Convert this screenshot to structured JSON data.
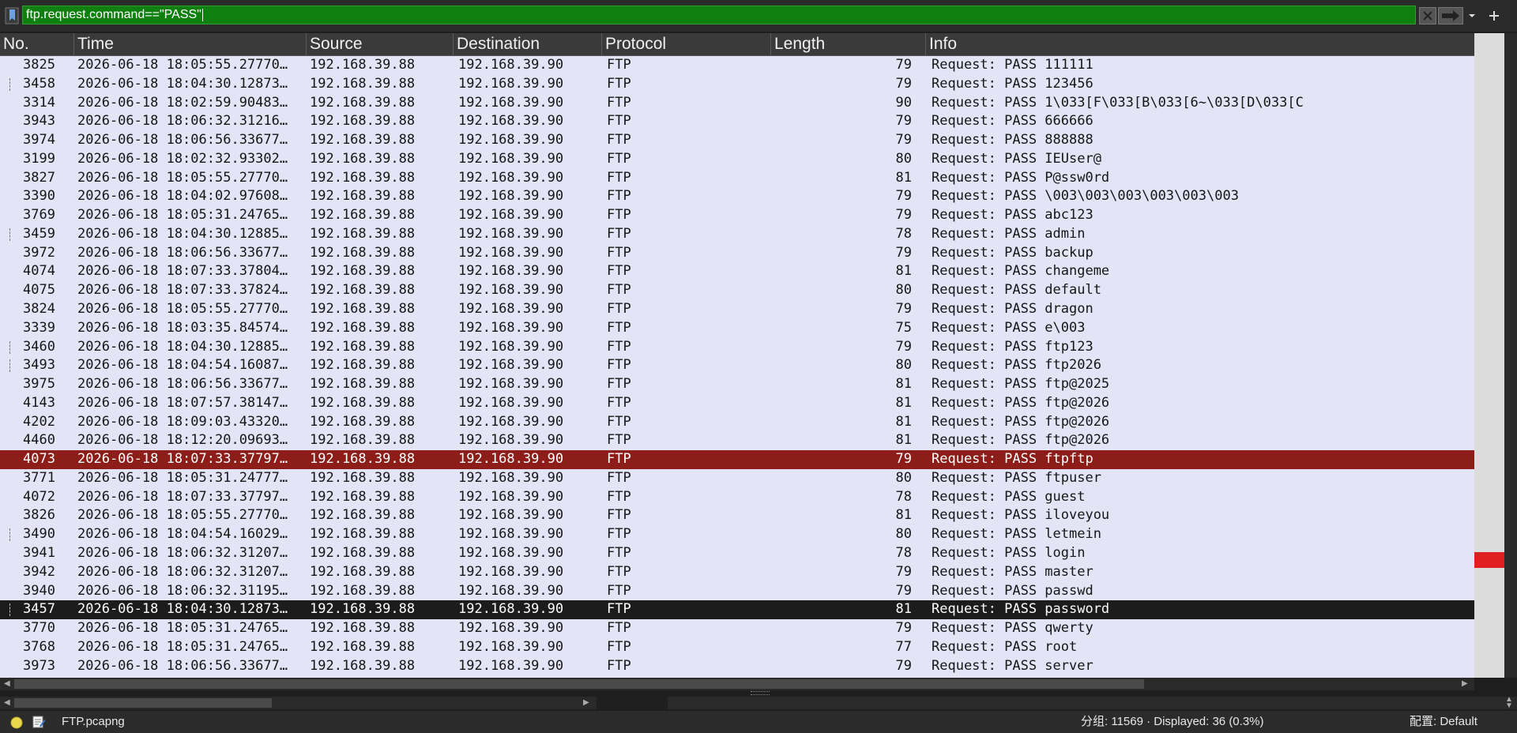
{
  "filter": {
    "expression": "ftp.request.command==\"PASS\"",
    "bookmark_icon": "bookmark-icon",
    "clear_icon": "clear-icon",
    "apply_icon": "arrow-right-icon",
    "dropdown_icon": "chevron-down-icon",
    "add_icon": "plus-icon",
    "active_color": "#0f7f0f"
  },
  "columns": [
    "No.",
    "Time",
    "Source",
    "Destination",
    "Protocol",
    "Length",
    "Info"
  ],
  "selection_colors": {
    "marked": "#8c1d18",
    "selected": "#1c1c1c",
    "row_bg": "#e4e4f7"
  },
  "packets": [
    {
      "no": "3825",
      "time": "2026-06-18 18:05:55.27770…",
      "src": "192.168.39.88",
      "dst": "192.168.39.90",
      "proto": "FTP",
      "len": "79",
      "info": "Request: PASS 111111",
      "state": "normal",
      "related": false
    },
    {
      "no": "3458",
      "time": "2026-06-18 18:04:30.12873…",
      "src": "192.168.39.88",
      "dst": "192.168.39.90",
      "proto": "FTP",
      "len": "79",
      "info": "Request: PASS 123456",
      "state": "normal",
      "related": true
    },
    {
      "no": "3314",
      "time": "2026-06-18 18:02:59.90483…",
      "src": "192.168.39.88",
      "dst": "192.168.39.90",
      "proto": "FTP",
      "len": "90",
      "info": "Request: PASS 1\\033[F\\033[B\\033[6~\\033[D\\033[C",
      "state": "normal",
      "related": false
    },
    {
      "no": "3943",
      "time": "2026-06-18 18:06:32.31216…",
      "src": "192.168.39.88",
      "dst": "192.168.39.90",
      "proto": "FTP",
      "len": "79",
      "info": "Request: PASS 666666",
      "state": "normal",
      "related": false
    },
    {
      "no": "3974",
      "time": "2026-06-18 18:06:56.33677…",
      "src": "192.168.39.88",
      "dst": "192.168.39.90",
      "proto": "FTP",
      "len": "79",
      "info": "Request: PASS 888888",
      "state": "normal",
      "related": false
    },
    {
      "no": "3199",
      "time": "2026-06-18 18:02:32.93302…",
      "src": "192.168.39.88",
      "dst": "192.168.39.90",
      "proto": "FTP",
      "len": "80",
      "info": "Request: PASS IEUser@",
      "state": "normal",
      "related": false
    },
    {
      "no": "3827",
      "time": "2026-06-18 18:05:55.27770…",
      "src": "192.168.39.88",
      "dst": "192.168.39.90",
      "proto": "FTP",
      "len": "81",
      "info": "Request: PASS P@ssw0rd",
      "state": "normal",
      "related": false
    },
    {
      "no": "3390",
      "time": "2026-06-18 18:04:02.97608…",
      "src": "192.168.39.88",
      "dst": "192.168.39.90",
      "proto": "FTP",
      "len": "79",
      "info": "Request: PASS \\003\\003\\003\\003\\003\\003",
      "state": "normal",
      "related": false
    },
    {
      "no": "3769",
      "time": "2026-06-18 18:05:31.24765…",
      "src": "192.168.39.88",
      "dst": "192.168.39.90",
      "proto": "FTP",
      "len": "79",
      "info": "Request: PASS abc123",
      "state": "normal",
      "related": false
    },
    {
      "no": "3459",
      "time": "2026-06-18 18:04:30.12885…",
      "src": "192.168.39.88",
      "dst": "192.168.39.90",
      "proto": "FTP",
      "len": "78",
      "info": "Request: PASS admin",
      "state": "normal",
      "related": true
    },
    {
      "no": "3972",
      "time": "2026-06-18 18:06:56.33677…",
      "src": "192.168.39.88",
      "dst": "192.168.39.90",
      "proto": "FTP",
      "len": "79",
      "info": "Request: PASS backup",
      "state": "normal",
      "related": false
    },
    {
      "no": "4074",
      "time": "2026-06-18 18:07:33.37804…",
      "src": "192.168.39.88",
      "dst": "192.168.39.90",
      "proto": "FTP",
      "len": "81",
      "info": "Request: PASS changeme",
      "state": "normal",
      "related": false
    },
    {
      "no": "4075",
      "time": "2026-06-18 18:07:33.37824…",
      "src": "192.168.39.88",
      "dst": "192.168.39.90",
      "proto": "FTP",
      "len": "80",
      "info": "Request: PASS default",
      "state": "normal",
      "related": false
    },
    {
      "no": "3824",
      "time": "2026-06-18 18:05:55.27770…",
      "src": "192.168.39.88",
      "dst": "192.168.39.90",
      "proto": "FTP",
      "len": "79",
      "info": "Request: PASS dragon",
      "state": "normal",
      "related": false
    },
    {
      "no": "3339",
      "time": "2026-06-18 18:03:35.84574…",
      "src": "192.168.39.88",
      "dst": "192.168.39.90",
      "proto": "FTP",
      "len": "75",
      "info": "Request: PASS e\\003",
      "state": "normal",
      "related": false
    },
    {
      "no": "3460",
      "time": "2026-06-18 18:04:30.12885…",
      "src": "192.168.39.88",
      "dst": "192.168.39.90",
      "proto": "FTP",
      "len": "79",
      "info": "Request: PASS ftp123",
      "state": "normal",
      "related": true
    },
    {
      "no": "3493",
      "time": "2026-06-18 18:04:54.16087…",
      "src": "192.168.39.88",
      "dst": "192.168.39.90",
      "proto": "FTP",
      "len": "80",
      "info": "Request: PASS ftp2026",
      "state": "normal",
      "related": true
    },
    {
      "no": "3975",
      "time": "2026-06-18 18:06:56.33677…",
      "src": "192.168.39.88",
      "dst": "192.168.39.90",
      "proto": "FTP",
      "len": "81",
      "info": "Request: PASS ftp@2025",
      "state": "normal",
      "related": false
    },
    {
      "no": "4143",
      "time": "2026-06-18 18:07:57.38147…",
      "src": "192.168.39.88",
      "dst": "192.168.39.90",
      "proto": "FTP",
      "len": "81",
      "info": "Request: PASS ftp@2026",
      "state": "normal",
      "related": false
    },
    {
      "no": "4202",
      "time": "2026-06-18 18:09:03.43320…",
      "src": "192.168.39.88",
      "dst": "192.168.39.90",
      "proto": "FTP",
      "len": "81",
      "info": "Request: PASS ftp@2026",
      "state": "normal",
      "related": false
    },
    {
      "no": "4460",
      "time": "2026-06-18 18:12:20.09693…",
      "src": "192.168.39.88",
      "dst": "192.168.39.90",
      "proto": "FTP",
      "len": "81",
      "info": "Request: PASS ftp@2026",
      "state": "normal",
      "related": false
    },
    {
      "no": "4073",
      "time": "2026-06-18 18:07:33.37797…",
      "src": "192.168.39.88",
      "dst": "192.168.39.90",
      "proto": "FTP",
      "len": "79",
      "info": "Request: PASS ftpftp",
      "state": "marked",
      "related": false
    },
    {
      "no": "3771",
      "time": "2026-06-18 18:05:31.24777…",
      "src": "192.168.39.88",
      "dst": "192.168.39.90",
      "proto": "FTP",
      "len": "80",
      "info": "Request: PASS ftpuser",
      "state": "normal",
      "related": false
    },
    {
      "no": "4072",
      "time": "2026-06-18 18:07:33.37797…",
      "src": "192.168.39.88",
      "dst": "192.168.39.90",
      "proto": "FTP",
      "len": "78",
      "info": "Request: PASS guest",
      "state": "normal",
      "related": false
    },
    {
      "no": "3826",
      "time": "2026-06-18 18:05:55.27770…",
      "src": "192.168.39.88",
      "dst": "192.168.39.90",
      "proto": "FTP",
      "len": "81",
      "info": "Request: PASS iloveyou",
      "state": "normal",
      "related": false
    },
    {
      "no": "3490",
      "time": "2026-06-18 18:04:54.16029…",
      "src": "192.168.39.88",
      "dst": "192.168.39.90",
      "proto": "FTP",
      "len": "80",
      "info": "Request: PASS letmein",
      "state": "normal",
      "related": true
    },
    {
      "no": "3941",
      "time": "2026-06-18 18:06:32.31207…",
      "src": "192.168.39.88",
      "dst": "192.168.39.90",
      "proto": "FTP",
      "len": "78",
      "info": "Request: PASS login",
      "state": "normal",
      "related": false
    },
    {
      "no": "3942",
      "time": "2026-06-18 18:06:32.31207…",
      "src": "192.168.39.88",
      "dst": "192.168.39.90",
      "proto": "FTP",
      "len": "79",
      "info": "Request: PASS master",
      "state": "normal",
      "related": false
    },
    {
      "no": "3940",
      "time": "2026-06-18 18:06:32.31195…",
      "src": "192.168.39.88",
      "dst": "192.168.39.90",
      "proto": "FTP",
      "len": "79",
      "info": "Request: PASS passwd",
      "state": "normal",
      "related": false
    },
    {
      "no": "3457",
      "time": "2026-06-18 18:04:30.12873…",
      "src": "192.168.39.88",
      "dst": "192.168.39.90",
      "proto": "FTP",
      "len": "81",
      "info": "Request: PASS password",
      "state": "selected",
      "related": true
    },
    {
      "no": "3770",
      "time": "2026-06-18 18:05:31.24765…",
      "src": "192.168.39.88",
      "dst": "192.168.39.90",
      "proto": "FTP",
      "len": "79",
      "info": "Request: PASS qwerty",
      "state": "normal",
      "related": false
    },
    {
      "no": "3768",
      "time": "2026-06-18 18:05:31.24765…",
      "src": "192.168.39.88",
      "dst": "192.168.39.90",
      "proto": "FTP",
      "len": "77",
      "info": "Request: PASS root",
      "state": "normal",
      "related": false
    },
    {
      "no": "3973",
      "time": "2026-06-18 18:06:56.33677…",
      "src": "192.168.39.88",
      "dst": "192.168.39.90",
      "proto": "FTP",
      "len": "79",
      "info": "Request: PASS server",
      "state": "normal",
      "related": false
    }
  ],
  "status": {
    "expert_icon": "expert-info-led-icon",
    "comment_icon": "capture-comment-icon",
    "file": "FTP.pcapng",
    "stats": "分组: 11569 · Displayed: 36 (0.3%)",
    "profile": "配置:  Default"
  },
  "minimap": {
    "mark_color": "#e02020"
  }
}
